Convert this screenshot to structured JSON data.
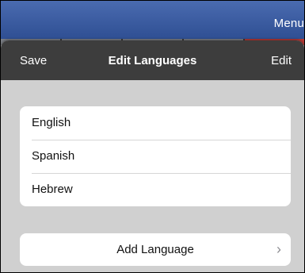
{
  "background": {
    "menu_label": "Menu"
  },
  "nav": {
    "left_label": "Save",
    "title": "Edit Languages",
    "right_label": "Edit"
  },
  "languages": [
    {
      "label": "English"
    },
    {
      "label": "Spanish"
    },
    {
      "label": "Hebrew"
    }
  ],
  "add_language": {
    "label": "Add Language",
    "icon": "chevron-right-icon"
  },
  "colors": {
    "nav_bar": "#3d3d3d",
    "sheet_background": "#d0d0d0",
    "app_bar": "#2f4f93"
  }
}
